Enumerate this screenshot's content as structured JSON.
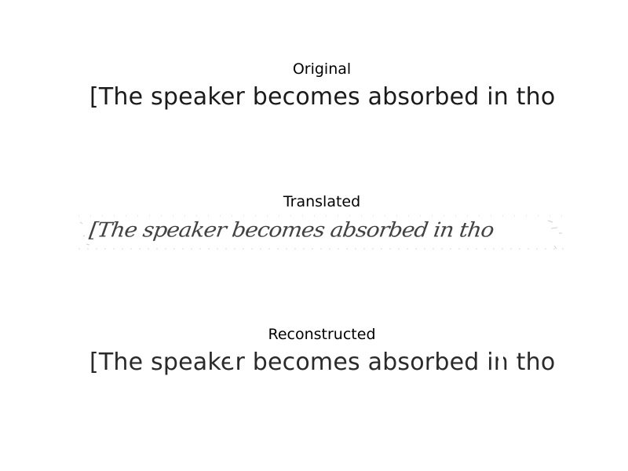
{
  "panels": [
    {
      "id": "original",
      "title": "Original",
      "text": "[The speaker becomes absorbed in tho"
    },
    {
      "id": "translated",
      "title": "Translated",
      "text": "[The speaker becomes absorbed in tho"
    },
    {
      "id": "reconstructed",
      "title": "Reconstructed",
      "text": "[The speaker becomes absorbed in tho"
    }
  ]
}
